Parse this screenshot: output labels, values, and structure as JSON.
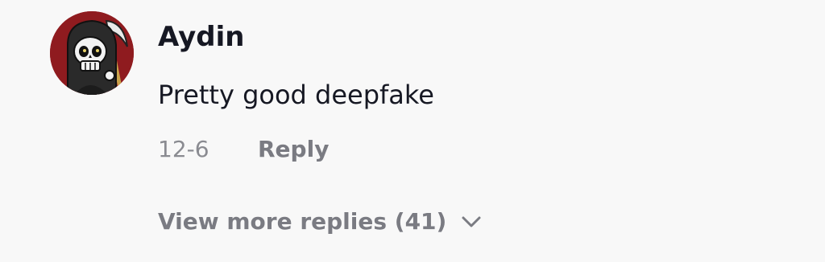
{
  "comment": {
    "avatar_icon": "grim-reaper-skull-avatar",
    "username": "Aydin",
    "text": "Pretty good deepfake",
    "date": "12-6",
    "reply_label": "Reply",
    "view_more_label": "View more replies (41)",
    "view_more_icon": "chevron-down-icon"
  },
  "colors": {
    "background": "#f8f8f8",
    "primary_text": "#161823",
    "secondary_text": "#8a8b91",
    "action_text": "#7a7b82",
    "avatar_bg": "#8f1b1f"
  }
}
